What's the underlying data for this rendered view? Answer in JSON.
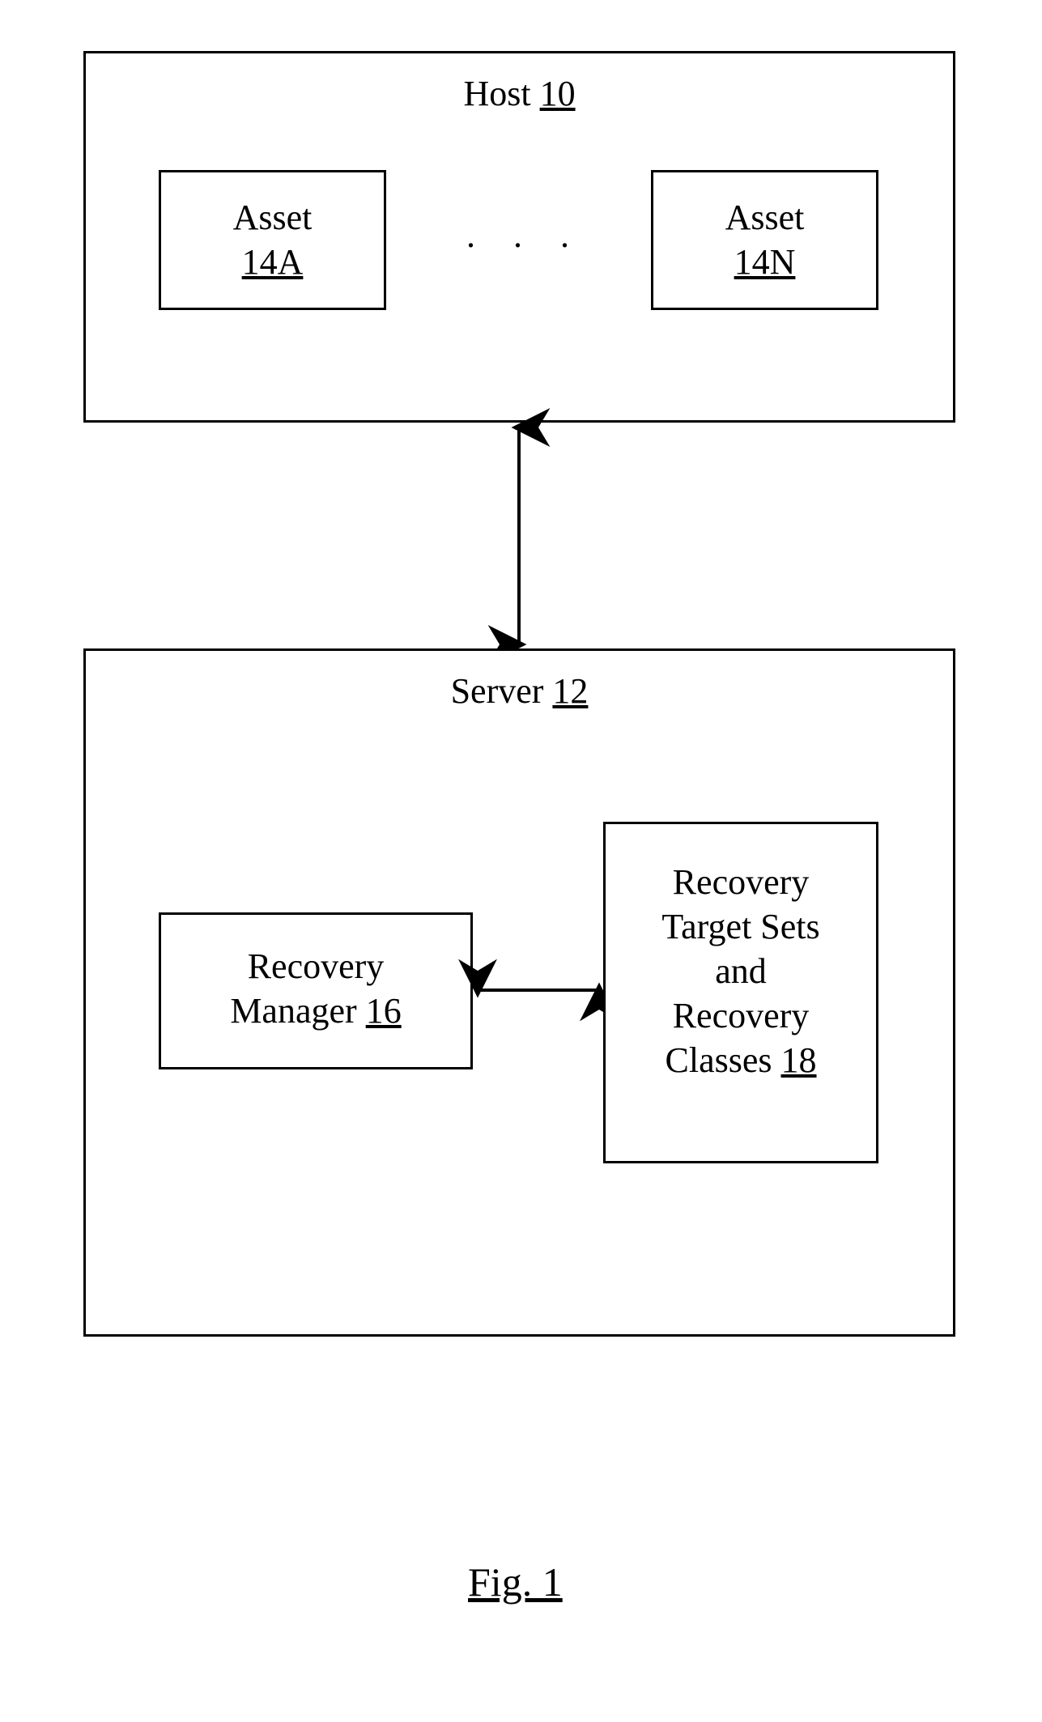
{
  "host": {
    "title_prefix": "Host ",
    "title_num": "10",
    "asset_a": {
      "label": "Asset",
      "num": "14A"
    },
    "asset_n": {
      "label": "Asset",
      "num": "14N"
    },
    "ellipsis": ". . ."
  },
  "server": {
    "title_prefix": "Server ",
    "title_num": "12",
    "recovery_manager": {
      "line1": "Recovery",
      "line2_prefix": "Manager ",
      "line2_num": "16"
    },
    "rts": {
      "l1": "Recovery",
      "l2": "Target Sets",
      "l3": "and",
      "l4": "Recovery",
      "l5_prefix": "Classes ",
      "l5_num": "18"
    }
  },
  "figure_caption": "Fig. 1"
}
